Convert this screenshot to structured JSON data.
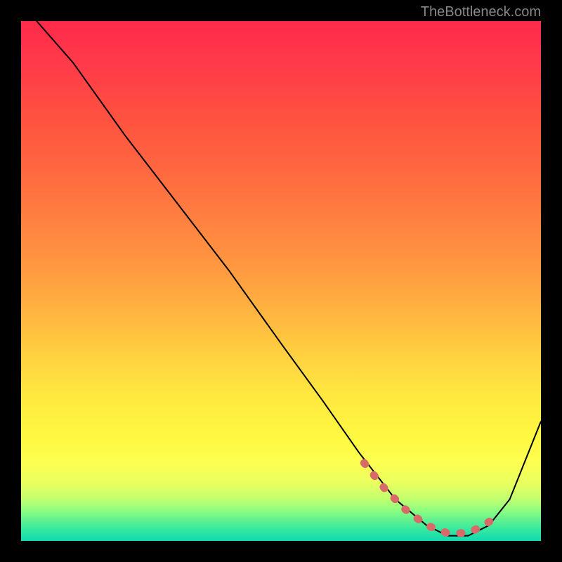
{
  "watermark": "TheBottleneck.com",
  "chart_data": {
    "type": "line",
    "title": "",
    "xlabel": "",
    "ylabel": "",
    "xlim": [
      0,
      100
    ],
    "ylim": [
      0,
      100
    ],
    "series": [
      {
        "name": "curve",
        "x": [
          3,
          10,
          20,
          30,
          40,
          50,
          58,
          65,
          72,
          78,
          82,
          86,
          90,
          94,
          100
        ],
        "y": [
          100,
          92,
          78,
          65,
          52,
          38,
          27,
          17,
          8,
          3,
          1,
          1,
          3,
          8,
          23
        ]
      },
      {
        "name": "highlight",
        "x": [
          66,
          70,
          74,
          78,
          82,
          86,
          89,
          92
        ],
        "y": [
          15,
          10,
          6,
          3,
          1.5,
          1.5,
          3,
          5
        ]
      }
    ],
    "colors": {
      "curve": "#000000",
      "highlight": "#d96a6a",
      "gradient_top": "#ff2a4a",
      "gradient_bottom": "#10d8b0"
    }
  }
}
